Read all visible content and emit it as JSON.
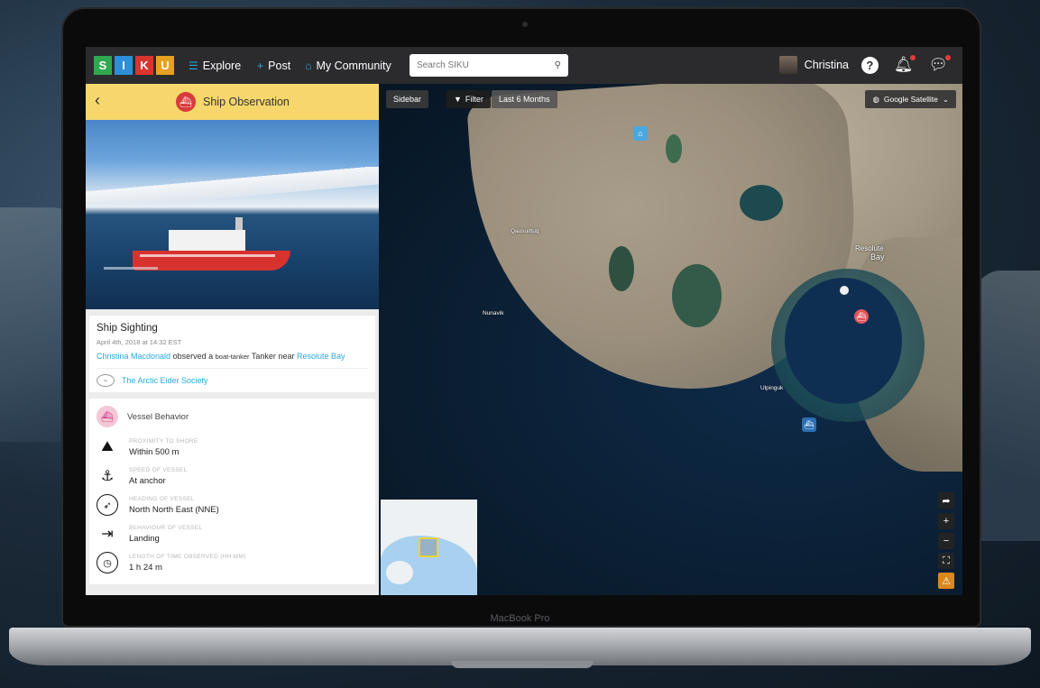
{
  "app": {
    "logo_letters": [
      {
        "letter": "S",
        "color": "#2fa84f"
      },
      {
        "letter": "I",
        "color": "#2d8ed8"
      },
      {
        "letter": "K",
        "color": "#d8352e"
      },
      {
        "letter": "U",
        "color": "#e7a11e"
      }
    ]
  },
  "nav": {
    "explore": "Explore",
    "post": "Post",
    "community": "My Community",
    "search_placeholder": "Search SIKU",
    "user_name": "Christina",
    "help_glyph": "?"
  },
  "sidebar": {
    "header_title": "Ship Observation",
    "sighting": {
      "title": "Ship Sighting",
      "timestamp": "April 4th, 2018 at 14:32 EST",
      "observer": "Christina Macdonald",
      "observed_text": "observed a",
      "vessel_type": "boat-tanker",
      "vessel_name": "Tanker",
      "near_text": "near",
      "location": "Resolute Bay",
      "organization": "The Arctic Eider Society"
    },
    "vessel": {
      "section_title": "Vessel Behavior",
      "rows": [
        {
          "label": "PROXIMITY TO SHORE",
          "value": "Within 500 m",
          "icon": "ship-icon"
        },
        {
          "label": "SPEED OF VESSEL",
          "value": "At anchor",
          "icon": "anchor-icon"
        },
        {
          "label": "HEADING OF VESSEL",
          "value": "North North East (NNE)",
          "icon": "compass-icon"
        },
        {
          "label": "BEHAVIOUR OF VESSEL",
          "value": "Landing",
          "icon": "landing-icon"
        },
        {
          "label": "LENGTH OF TIME OBSERVED (HH:MM)",
          "value": "1 h 24 m",
          "icon": "clock-icon"
        }
      ]
    }
  },
  "map": {
    "sidebar_btn": "Sidebar",
    "filter_btn": "Filter",
    "range_btn": "Last 6 Months",
    "layer_select": "Google Satellite",
    "labels": {
      "qausuittuq": "Qausuittuq",
      "nunavik": "Nunavik",
      "resolute": "Resolute",
      "bay": "Bay",
      "ulpinguk": "Ulpinguk"
    }
  },
  "device": {
    "label": "MacBook Pro"
  }
}
